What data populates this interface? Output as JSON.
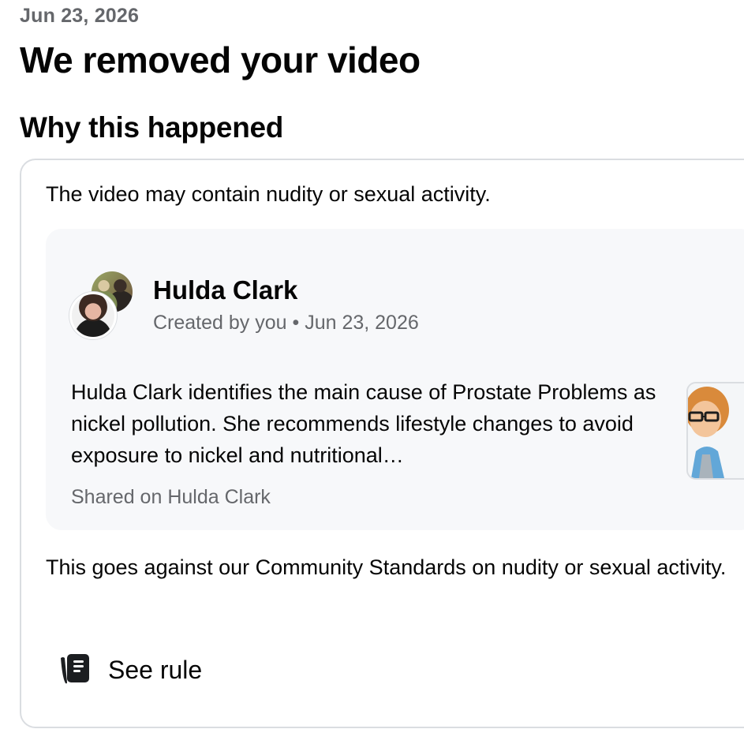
{
  "header": {
    "date": "Jun 23, 2026",
    "title": "We removed your video",
    "section_title": "Why this happened"
  },
  "card": {
    "reason": "The video may contain nudity or sexual activity.",
    "post": {
      "author": "Hulda Clark",
      "meta": "Created by you • Jun 23, 2026",
      "text": "Hulda Clark identifies the main cause of Prostate Problems as nickel pollution. She recommends lifestyle changes to avoid exposure to nickel and nutritional…",
      "shared_on": "Shared on Hulda Clark",
      "avatar_icons": [
        "group-avatar",
        "profile-avatar"
      ],
      "thumbnail_icon": "cartoon-video-thumbnail"
    },
    "standards_text": "This goes against our Community Standards on nudity or sexual activity.",
    "see_rule": {
      "label": "See rule",
      "icon": "rules-document-icon"
    }
  },
  "colors": {
    "text_primary": "#050505",
    "text_secondary": "#65676b",
    "card_border": "#dadde1",
    "post_background": "#f7f8fa"
  }
}
